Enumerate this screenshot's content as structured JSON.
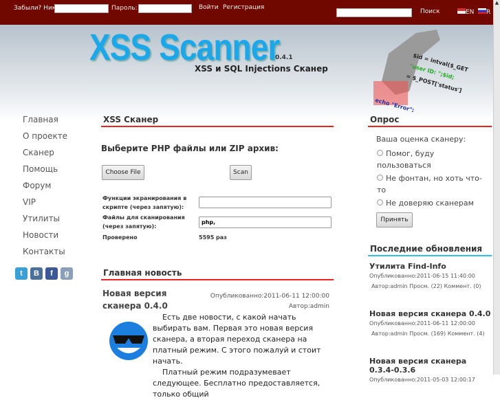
{
  "top": {
    "forgot": "Забыли? Ник:",
    "password": "Пароль:",
    "login": "Войти",
    "register": "Регистрация",
    "search": "Поиск",
    "lang_en": "EN",
    "lang_ru": "R"
  },
  "banner": {
    "logo": "XSS Scanner",
    "version": "0.4.1",
    "subtitle": "XSS и SQL Injections Сканер"
  },
  "nav": [
    "Главная",
    "О проекте",
    "Сканер",
    "Помощь",
    "Форум",
    "VIP",
    "Утилиты",
    "Новости",
    "Контакты"
  ],
  "social": [
    {
      "icon": "twitter-icon",
      "glyph": "t",
      "color": "#3aa0d8"
    },
    {
      "icon": "vk-icon",
      "glyph": "B",
      "color": "#4a6f98"
    },
    {
      "icon": "facebook-icon",
      "glyph": "f",
      "color": "#3b5998"
    },
    {
      "icon": "google-icon",
      "glyph": "g",
      "color": "#8aa0b8"
    }
  ],
  "scanner": {
    "title": "XSS Сканер",
    "prompt": "Выберите PHP файлы или ZIP архив:",
    "choose": "Choose File",
    "scan": "Scan",
    "func_label": "Функции экранирования в скрипте (через запятую):",
    "func_value": "",
    "files_label": "Файлы для сканирования (через запятую):",
    "files_value": "php,",
    "checked_label": "Проверено",
    "checked_value": "5595 раз"
  },
  "news": {
    "title": "Главная новость",
    "headline": "Новая версия сканера 0.4.0",
    "published": "Опубликованно:2011-06-11 12:00:00",
    "author": "Автор:admin",
    "p1": "Есть две новости, с какой начать выбирать вам. Первая это новая версия сканера, а вторая переход сканера на платный режим. С этого пожалуй и стоит начать.",
    "p2": "Платный режим подразумевает следующее. Бесплатно предоставляется, только общий"
  },
  "poll": {
    "title": "Опрос",
    "question": "Ваша оценка сканеру:",
    "options": [
      "Помог, буду пользоваться",
      "Не фонтан, но хоть что-то",
      "Не доверяю сканерам"
    ],
    "submit": "Принять"
  },
  "updates": {
    "title": "Последние обновления",
    "items": [
      {
        "title": "Утилита Find-Info",
        "published": "Опубликованно:2011-06-15 11:40:00",
        "meta": "Автор:admin Просм. (22) Коммент. (0)"
      },
      {
        "title": "Новая версия сканера 0.4.0",
        "published": "Опубликованно:2011-06-11 12:00:00",
        "meta": "Автор:admin Просм. (169) Коммент. (4)"
      },
      {
        "title": "Новая версия сканера 0.3.4-0.3.6",
        "published": "Опубликованно:2011-05-03 12:00:17",
        "meta": ""
      }
    ]
  }
}
